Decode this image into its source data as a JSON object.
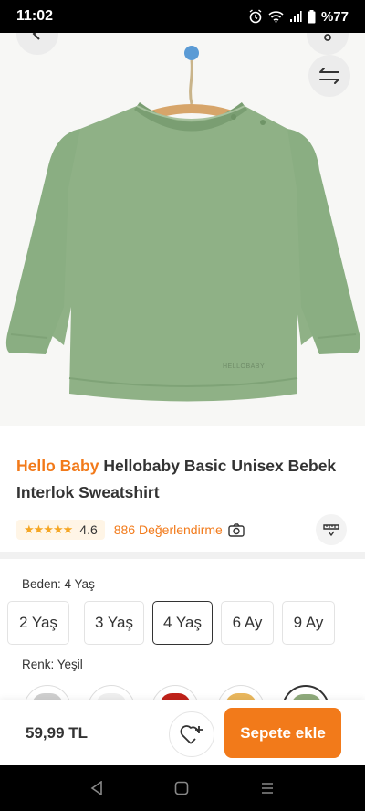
{
  "status_bar": {
    "time": "11:02",
    "battery": "%77"
  },
  "product": {
    "brand": "Hello Baby",
    "name": "Hellobaby Basic Unisex Bebek Interlok Sweatshirt",
    "rating": "4.6",
    "reviews": "886 Değerlendirme",
    "garment_label": "HELLOBABY"
  },
  "size": {
    "label": "Beden: 4 Yaş",
    "options": [
      "2 Yaş",
      "3 Yaş",
      "4 Yaş",
      "6 Ay",
      "9 Ay"
    ],
    "selected": "4 Yaş"
  },
  "color": {
    "label": "Renk: Yeşil",
    "swatches": [
      "#cfcfcf",
      "#efefef",
      "#c0221a",
      "#e9b75d",
      "#8faa7c"
    ],
    "selected_index": 4
  },
  "bottom_bar": {
    "price": "59,99 TL",
    "add_to_cart": "Sepete ekle"
  },
  "colors": {
    "accent": "#f27a1a",
    "garment": "#8fb186",
    "star": "#f5a623"
  }
}
